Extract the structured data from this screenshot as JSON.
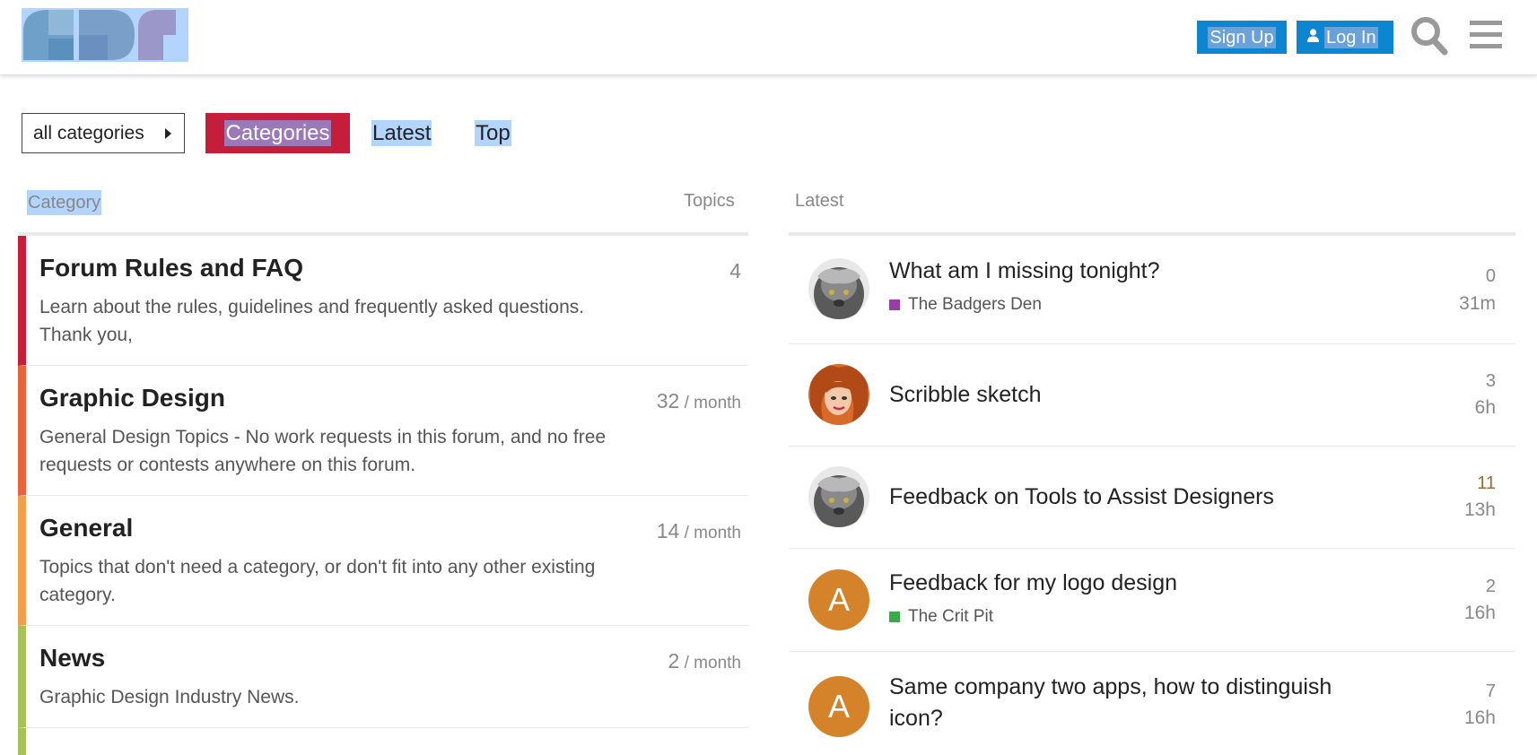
{
  "header": {
    "signup_label": "Sign Up",
    "login_label": "Log In",
    "accent_color": "#0c86d0"
  },
  "nav": {
    "category_dropdown": "all categories",
    "pills": [
      "Categories",
      "Latest",
      "Top"
    ],
    "active_pill_color": "#c41e3a"
  },
  "columns": {
    "category": "Category",
    "topics": "Topics",
    "latest": "Latest"
  },
  "categories": [
    {
      "name": "Forum Rules and FAQ",
      "description": "Learn about the rules, guidelines and frequently asked questions. Thank you,",
      "count": "4",
      "unit": "",
      "color": "#c41e3a"
    },
    {
      "name": "Graphic Design",
      "description": "General Design Topics - No work requests in this forum, and no free requests or contests anywhere on this forum.",
      "count": "32",
      "unit": " / month",
      "color": "#e8623a"
    },
    {
      "name": "General",
      "description": "Topics that don't need a category, or don't fit into any other existing category.",
      "count": "14",
      "unit": " / month",
      "color": "#f0a04a"
    },
    {
      "name": "News",
      "description": "Graphic Design Industry News.",
      "count": "2",
      "unit": " / month",
      "color": "#a8c25a"
    }
  ],
  "latest": [
    {
      "title": "What am I missing tonight?",
      "category": "The Badgers Den",
      "category_color": "#9b3ba8",
      "replies": "0",
      "age": "31m",
      "avatar": "cat-avatar"
    },
    {
      "title": "Scribble sketch",
      "category": "",
      "category_color": "",
      "replies": "3",
      "age": "6h",
      "avatar": "woman-avatar"
    },
    {
      "title": "Feedback on Tools to Assist Designers",
      "category": "",
      "category_color": "",
      "replies": "11",
      "age": "13h",
      "avatar": "cat-avatar"
    },
    {
      "title": "Feedback for my logo design",
      "category": "The Crit Pit",
      "category_color": "#3aaa4a",
      "replies": "2",
      "age": "16h",
      "avatar": "letter-avatar",
      "avatar_letter": "A"
    },
    {
      "title": "Same company two apps, how to distinguish icon?",
      "category": "",
      "category_color": "",
      "replies": "7",
      "age": "16h",
      "avatar": "letter-avatar",
      "avatar_letter": "A"
    }
  ]
}
